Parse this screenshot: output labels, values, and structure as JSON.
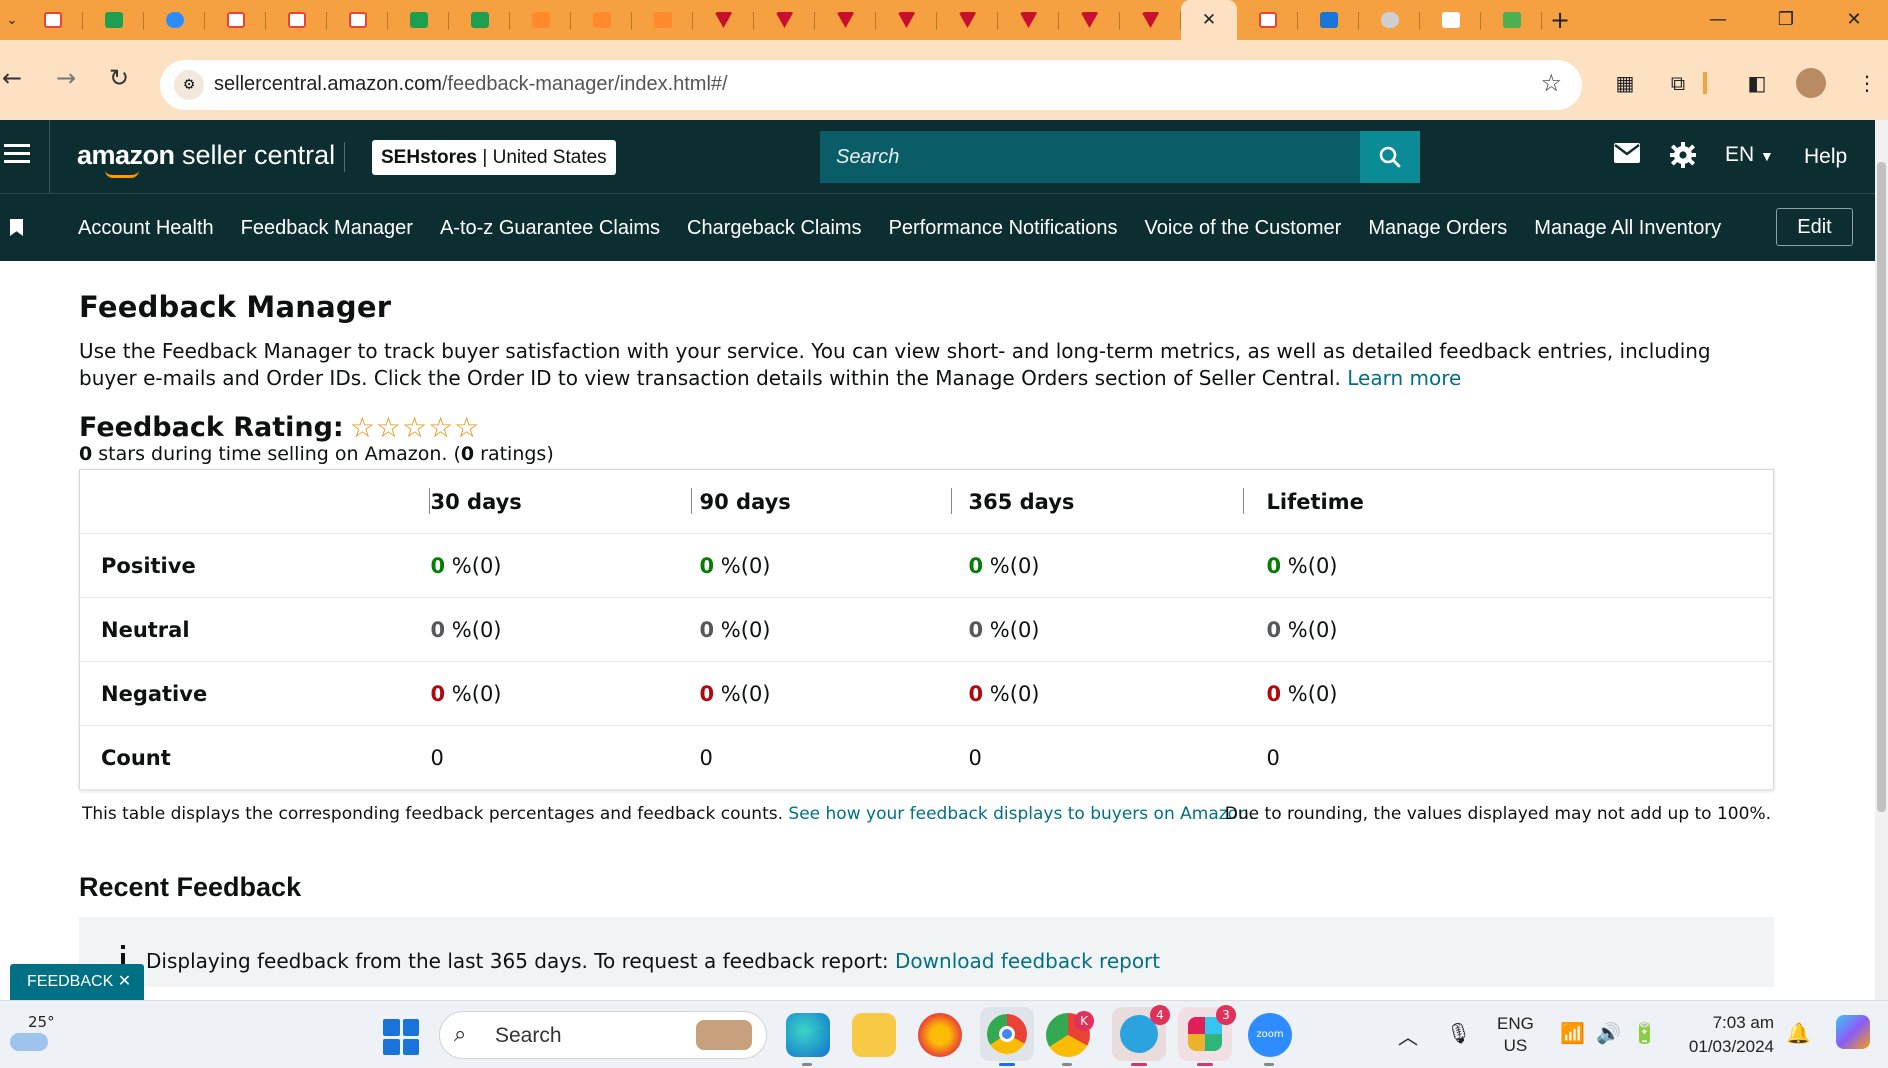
{
  "browser": {
    "url_host": "sellercentral.amazon.com",
    "url_path": "/feedback-manager/index.html#/",
    "tab_favicons": [
      "gmail",
      "sheets",
      "zoom",
      "gmail",
      "gmail",
      "gmail",
      "sheets",
      "sheets",
      "pencil",
      "pencil",
      "pencil",
      "tri",
      "tri",
      "tri",
      "tri",
      "tri",
      "tri",
      "tri",
      "tri"
    ],
    "after_active_favicons": [
      "gmail",
      "r",
      "grey",
      "amazon",
      "n"
    ],
    "active_tab_close": "✕",
    "new_tab": "+",
    "minimize": "—",
    "restore": "❐",
    "close": "✕"
  },
  "header": {
    "logo_bold": "amazon",
    "logo_rest": " seller central",
    "store_name": "SEHstores",
    "store_sep": " | ",
    "store_region": "United States",
    "search_placeholder": "Search",
    "language": "EN",
    "help": "Help"
  },
  "nav": {
    "links": [
      "Account Health",
      "Feedback Manager",
      "A-to-z Guarantee Claims",
      "Chargeback Claims",
      "Performance Notifications",
      "Voice of the Customer",
      "Manage Orders",
      "Manage All Inventory"
    ],
    "edit": "Edit"
  },
  "page": {
    "title": "Feedback Manager",
    "intro": "Use the Feedback Manager to track buyer satisfaction with your service. You can view short- and long-term metrics, as well as detailed feedback entries, including buyer e-mails and Order IDs. Click the Order ID to view transaction details within the Manage Orders section of Seller Central. ",
    "learn_more": "Learn more",
    "rating_label": "Feedback Rating:",
    "stars_rating": 0,
    "stars_max": 5,
    "stars_note_count": "0",
    "stars_note_mid": " stars during time selling on Amazon. (",
    "stars_note_ratings": "0",
    "stars_note_end": " ratings)"
  },
  "table": {
    "columns": [
      "30 days",
      "90 days",
      "365 days",
      "Lifetime"
    ],
    "rows": [
      {
        "label": "Positive",
        "tone": "green",
        "cells": [
          [
            "0",
            " %(0)"
          ],
          [
            "0",
            " %(0)"
          ],
          [
            "0",
            " %(0)"
          ],
          [
            "0",
            " %(0)"
          ]
        ]
      },
      {
        "label": "Neutral",
        "tone": "grey",
        "cells": [
          [
            "0",
            " %(0)"
          ],
          [
            "0",
            " %(0)"
          ],
          [
            "0",
            " %(0)"
          ],
          [
            "0",
            " %(0)"
          ]
        ]
      },
      {
        "label": "Negative",
        "tone": "red",
        "cells": [
          [
            "0",
            " %(0)"
          ],
          [
            "0",
            " %(0)"
          ],
          [
            "0",
            " %(0)"
          ],
          [
            "0",
            " %(0)"
          ]
        ]
      },
      {
        "label": "Count",
        "tone": "plain",
        "cells": [
          [
            "",
            "0"
          ],
          [
            "",
            "0"
          ],
          [
            "",
            "0"
          ],
          [
            "",
            "0"
          ]
        ]
      }
    ],
    "footnote_left": "This table displays the corresponding feedback percentages and feedback counts. ",
    "footnote_link": "See how your feedback displays to buyers on Amazon.",
    "footnote_right": "Due to rounding, the values displayed may not add up to 100%."
  },
  "recent": {
    "title": "Recent Feedback",
    "message": "Displaying feedback from the last 365 days. To request a feedback report: ",
    "link": "Download feedback report"
  },
  "feedback_tab": "FEEDBACK ✕",
  "taskbar": {
    "temperature": "25°",
    "search": "Search",
    "badges": {
      "app_k": "K",
      "telegram": "4",
      "slack": "3"
    },
    "zoom_label": "zoom",
    "lang_top": "ENG",
    "lang_bottom": "US",
    "time": "7:03 am",
    "date": "01/03/2024"
  },
  "colors": {
    "header_bg": "#0d2e31",
    "search_button": "#0a8b95",
    "link": "#007185",
    "positive": "#067d06",
    "negative": "#b0090e",
    "star": "#e88f0c",
    "tab_strip": "#f5a041"
  }
}
